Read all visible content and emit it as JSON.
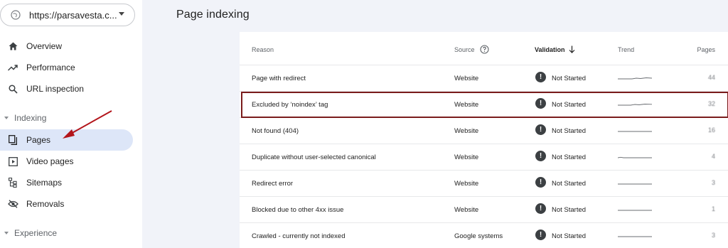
{
  "property": {
    "url": "https://parsavesta.c..."
  },
  "nav": {
    "overview": "Overview",
    "performance": "Performance",
    "url_inspection": "URL inspection",
    "indexing_section": "Indexing",
    "pages": "Pages",
    "video_pages": "Video pages",
    "sitemaps": "Sitemaps",
    "removals": "Removals",
    "experience_section": "Experience"
  },
  "page": {
    "title": "Page indexing"
  },
  "table": {
    "headers": {
      "reason": "Reason",
      "source": "Source",
      "validation": "Validation",
      "trend": "Trend",
      "pages": "Pages"
    },
    "rows": [
      {
        "reason": "Page with redirect",
        "source": "Website",
        "validation": "Not Started",
        "pages": "44"
      },
      {
        "reason": "Excluded by ‘noindex’ tag",
        "source": "Website",
        "validation": "Not Started",
        "pages": "32"
      },
      {
        "reason": "Not found (404)",
        "source": "Website",
        "validation": "Not Started",
        "pages": "16"
      },
      {
        "reason": "Duplicate without user-selected canonical",
        "source": "Website",
        "validation": "Not Started",
        "pages": "4"
      },
      {
        "reason": "Redirect error",
        "source": "Website",
        "validation": "Not Started",
        "pages": "3"
      },
      {
        "reason": "Blocked due to other 4xx issue",
        "source": "Website",
        "validation": "Not Started",
        "pages": "1"
      },
      {
        "reason": "Crawled - currently not indexed",
        "source": "Google systems",
        "validation": "Not Started",
        "pages": "3"
      }
    ]
  },
  "colors": {
    "highlight_box": "#7a1c1c",
    "arrow": "#b3151b",
    "active_nav": "#dde6f8",
    "status_icon": "#3c4043"
  }
}
